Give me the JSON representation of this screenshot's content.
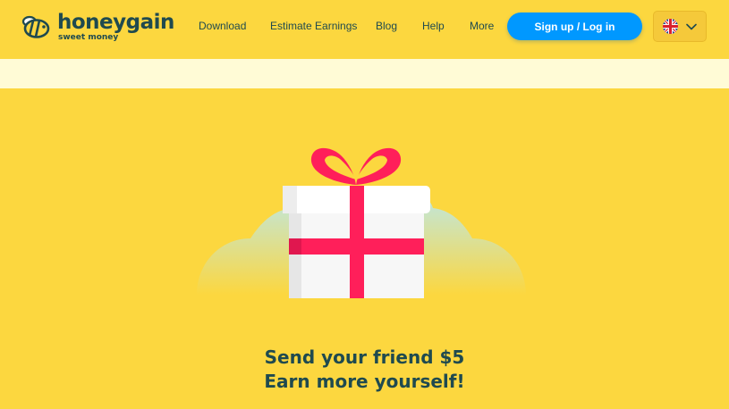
{
  "header": {
    "logo": {
      "name": "honeygain",
      "tagline": "sweet money",
      "icon": "bee-icon"
    },
    "nav": [
      {
        "label": "Download"
      },
      {
        "label": "Estimate Earnings"
      },
      {
        "label": "Blog"
      },
      {
        "label": "Help"
      },
      {
        "label": "More"
      }
    ],
    "signup_label": "Sign up / Log in",
    "language": {
      "icon": "uk-flag-icon",
      "dropdown_icon": "chevron-down-icon"
    }
  },
  "hero": {
    "illustration": "gift-box-icon",
    "headline_line1": "Send your friend $5",
    "headline_line2": "Earn more yourself!"
  },
  "colors": {
    "background": "#fcd73f",
    "banner": "#fffbd6",
    "accent": "#0098ff",
    "text": "#1f4a4f",
    "ribbon": "#ff1f5a"
  }
}
